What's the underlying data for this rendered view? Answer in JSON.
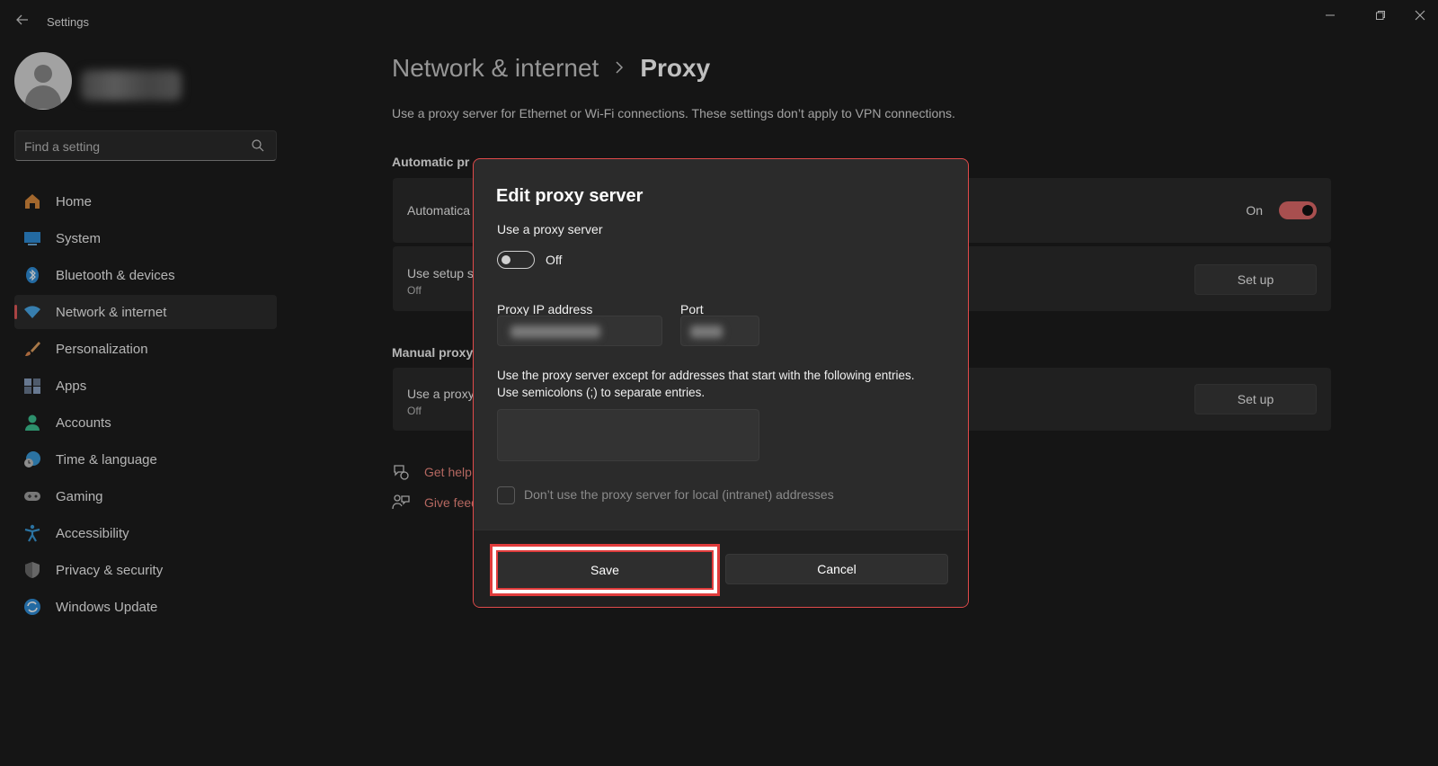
{
  "window": {
    "title": "Settings",
    "controls": [
      "minimize",
      "restore",
      "close"
    ]
  },
  "sidebar": {
    "search_placeholder": "Find a setting",
    "items": [
      {
        "label": "Home",
        "icon": "home-icon",
        "color": "#d88a3c"
      },
      {
        "label": "System",
        "icon": "monitor-icon",
        "color": "#2f8ed8"
      },
      {
        "label": "Bluetooth & devices",
        "icon": "bluetooth-icon",
        "color": "#2f8ed8"
      },
      {
        "label": "Network & internet",
        "icon": "wifi-icon",
        "color": "#4aa8e8",
        "selected": true
      },
      {
        "label": "Personalization",
        "icon": "brush-icon",
        "color": "#e08a50"
      },
      {
        "label": "Apps",
        "icon": "apps-icon",
        "color": "#8aa0c0"
      },
      {
        "label": "Accounts",
        "icon": "person-icon",
        "color": "#3cc090"
      },
      {
        "label": "Time & language",
        "icon": "globe-clock-icon",
        "color": "#3a9ad8"
      },
      {
        "label": "Gaming",
        "icon": "gamepad-icon",
        "color": "#a0a0a0"
      },
      {
        "label": "Accessibility",
        "icon": "accessibility-icon",
        "color": "#3a9ad8"
      },
      {
        "label": "Privacy & security",
        "icon": "shield-icon",
        "color": "#8a8a8a"
      },
      {
        "label": "Windows Update",
        "icon": "sync-icon",
        "color": "#2f8ed8"
      }
    ]
  },
  "main": {
    "breadcrumb_parent": "Network & internet",
    "breadcrumb_current": "Proxy",
    "description": "Use a proxy server for Ethernet or Wi-Fi connections. These settings don’t apply to VPN connections.",
    "auto_section_title": "Automatic pr",
    "auto_detect_label": "Automatica",
    "auto_detect_state": "On",
    "setup_script_label": "Use setup s",
    "setup_script_state": "Off",
    "setup_button": "Set up",
    "manual_section_title": "Manual proxy",
    "manual_label": "Use a proxy",
    "manual_state": "Off",
    "manual_button": "Set up",
    "get_help": "Get help",
    "give_feedback": "Give feed"
  },
  "dialog": {
    "title": "Edit proxy server",
    "use_proxy_label": "Use a proxy server",
    "toggle_state": "Off",
    "ip_label": "Proxy IP address",
    "port_label": "Port",
    "exceptions_line1": "Use the proxy server except for addresses that start with the following entries.",
    "exceptions_line2": "Use semicolons (;) to separate entries.",
    "local_checkbox_label": "Don’t use the proxy server for local (intranet) addresses",
    "save_button": "Save",
    "cancel_button": "Cancel"
  },
  "colors": {
    "accent": "#e06a6a",
    "highlight_border": "#e03c3c",
    "link": "#f08a80"
  }
}
